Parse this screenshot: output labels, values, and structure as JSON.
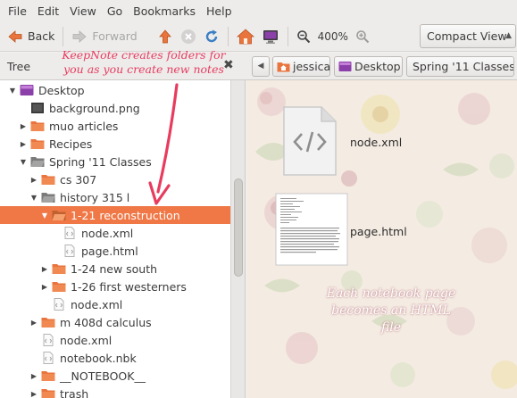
{
  "menubar": {
    "items": [
      "File",
      "Edit",
      "View",
      "Go",
      "Bookmarks",
      "Help"
    ]
  },
  "toolbar": {
    "back_label": "Back",
    "forward_label": "Forward",
    "zoom": "400%",
    "view_mode": "Compact View"
  },
  "location": {
    "tree_label": "Tree",
    "close_symbol": "✖",
    "crumbs": [
      "jessica",
      "Desktop",
      "Spring '11 Classes"
    ]
  },
  "tree": {
    "rows": [
      {
        "label": "Desktop",
        "expander": "▼",
        "icon": "desktop"
      },
      {
        "label": "background.png",
        "expander": "",
        "icon": "image"
      },
      {
        "label": "muo articles",
        "expander": "▶",
        "icon": "folder"
      },
      {
        "label": "Recipes",
        "expander": "▶",
        "icon": "folder"
      },
      {
        "label": "Spring '11 Classes",
        "expander": "▼",
        "icon": "folder-open"
      },
      {
        "label": "cs 307",
        "expander": "▶",
        "icon": "folder"
      },
      {
        "label": "history 315 l",
        "expander": "▼",
        "icon": "folder-open"
      },
      {
        "label": "1-21 reconstruction",
        "expander": "▼",
        "icon": "folder-open-orange"
      },
      {
        "label": "node.xml",
        "expander": "",
        "icon": "file"
      },
      {
        "label": "page.html",
        "expander": "",
        "icon": "file"
      },
      {
        "label": "1-24 new south",
        "expander": "▶",
        "icon": "folder-orange"
      },
      {
        "label": "1-26 first westerners",
        "expander": "▶",
        "icon": "folder-orange"
      },
      {
        "label": "node.xml",
        "expander": "",
        "icon": "file"
      },
      {
        "label": "m 408d calculus",
        "expander": "▶",
        "icon": "folder-orange"
      },
      {
        "label": "node.xml",
        "expander": "",
        "icon": "file"
      },
      {
        "label": "notebook.nbk",
        "expander": "",
        "icon": "file"
      },
      {
        "label": "__NOTEBOOK__",
        "expander": "▶",
        "icon": "folder-orange"
      },
      {
        "label": "trash",
        "expander": "▶",
        "icon": "folder-orange"
      }
    ]
  },
  "content": {
    "files": [
      {
        "name": "node.xml",
        "icon": "xml-file-icon"
      },
      {
        "name": "page.html",
        "icon": "html-page-thumbnail"
      }
    ]
  },
  "annotations": {
    "top": [
      "KeepNote creates folders for",
      "you as you create new notes"
    ],
    "bottom": [
      "Each notebook page",
      "becomes an HTML file"
    ]
  },
  "colors": {
    "selection": "#f07746",
    "annotation": "#e83c5f",
    "accent_folder": "#e9743e"
  }
}
